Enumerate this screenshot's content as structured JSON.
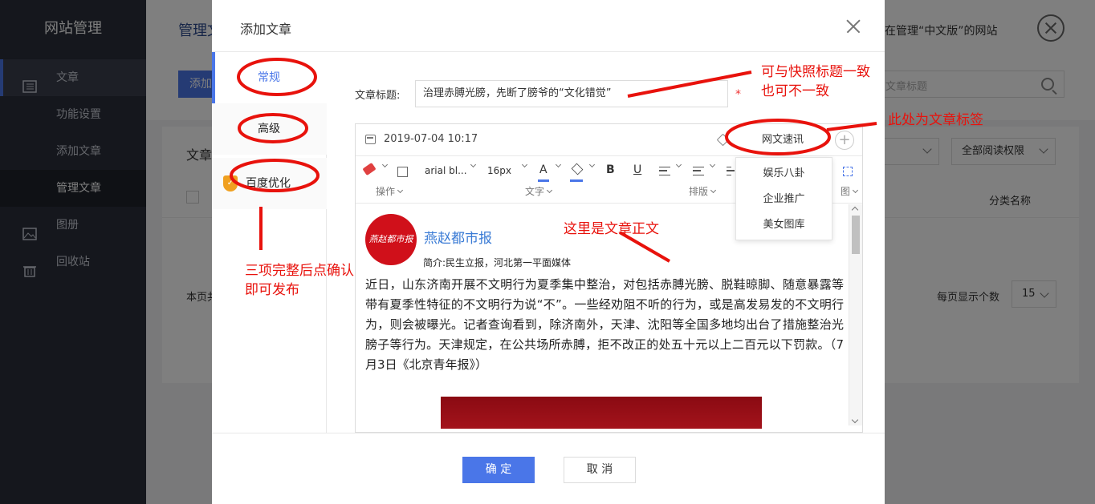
{
  "sidebar": {
    "brand": "网站管理",
    "items": [
      {
        "label": "文章",
        "icon": "article-icon"
      },
      {
        "label": "功能设置"
      },
      {
        "label": "添加文章"
      },
      {
        "label": "管理文章"
      },
      {
        "label": "图册",
        "icon": "image-icon"
      },
      {
        "label": "回收站",
        "icon": "trash-icon"
      }
    ]
  },
  "topbar": {
    "crumb": "管理文",
    "site_note": "在管理“中文版”的网站"
  },
  "toolbar": {
    "add_label": "添加",
    "search_placeholder": "文章标题"
  },
  "panel": {
    "title": "文章",
    "filter_read_perm": "全部阅读权限",
    "col_category": "分类名称",
    "footer_left": "本页共",
    "per_page_label": "每页显示个数",
    "per_page_value": "15"
  },
  "modal": {
    "title": "添加文章",
    "tabs": [
      {
        "label": "常规"
      },
      {
        "label": "高级"
      },
      {
        "label": "百度优化"
      }
    ],
    "title_field_label": "文章标题:",
    "title_value": "治理赤膊光膀，先断了膀爷的“文化错觉”",
    "required_mark": "*",
    "editor": {
      "date": "2019-07-04 10:17",
      "tag": "网文速讯",
      "tag_options": [
        "娱乐八卦",
        "企业推广",
        "美女图库"
      ],
      "toolbar": {
        "font_family": "arial bl...",
        "font_size": "16px",
        "bold": "B",
        "underline": "U",
        "color_letter": "A",
        "groups": [
          "操作",
          "文字",
          "排版",
          "图"
        ]
      },
      "source_logo_text": "燕赵都市报",
      "source_name": "燕赵都市报",
      "source_intro": "简介:民生立报，河北第一平面媒体",
      "body": "近日，山东济南开展不文明行为夏季集中整治，对包括赤膊光膀、脱鞋晾脚、随意暴露等带有夏季性特征的不文明行为说“不”。一些经劝阻不听的行为，或是高发易发的不文明行为，则会被曝光。记者查询看到，除济南外，天津、沈阳等全国多地均出台了措施整治光膀子等行为。天津规定，在公共场所赤膊，拒不改正的处五十元以上二百元以下罚款。（7月3日《北京青年报》）"
    },
    "ok_label": "确 定",
    "cancel_label": "取 消"
  },
  "annotations": {
    "title_note_1": "可与快照标题一致",
    "title_note_2": "也可不一致",
    "tag_note": "此处为文章标签",
    "body_note": "这里是文章正文",
    "publish_note_1": "三项完整后点确认",
    "publish_note_2": "即可发布",
    "color": "#e8120c"
  }
}
